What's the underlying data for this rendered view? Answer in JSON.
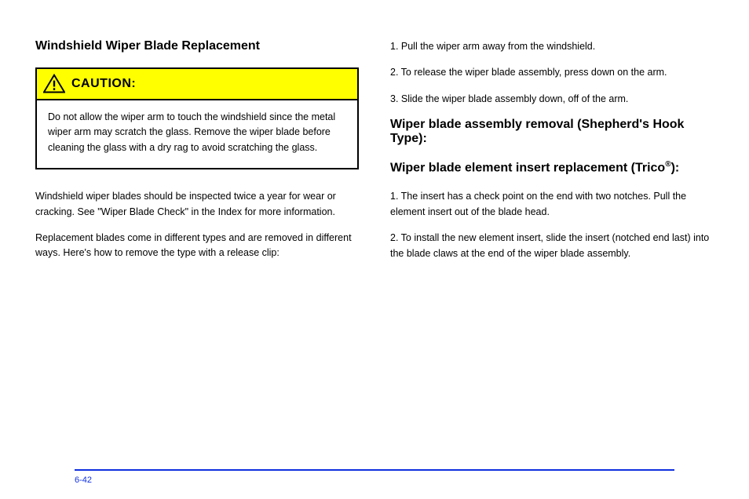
{
  "leftHeading": "Windshield Wiper Blade Replacement",
  "cautionLabel": "CAUTION:",
  "cautionBody": "Do not allow the wiper arm to touch the windshield since the metal wiper arm may scratch the glass. Remove the wiper blade before cleaning the glass with a dry rag to avoid scratching the glass.",
  "leftPara1": "Windshield wiper blades should be inspected twice a year for wear or cracking. See \"Wiper Blade Check\" in the Index for more information.",
  "leftPara2": "Replacement blades come in different types and are removed in different ways. Here's how to remove the type with a release clip:",
  "rightHeading1": "Wiper blade assembly removal (Shepherd's Hook Type):",
  "rightHeading2": "Wiper blade element insert replacement (Trico",
  "rightHeading2Suffix": "):",
  "rightStep1": "1. Pull the wiper arm away from the windshield.",
  "rightStep2": "2. To release the wiper blade assembly, press down on the arm.",
  "rightStep3": "3. Slide the wiper blade assembly down, off of the arm.",
  "rightInsert1": "1. The insert has a check point on the end with two notches. Pull the element insert out of the blade head.",
  "rightInsert2": "2. To install the new element insert, slide the insert (notched end last) into the blade claws at the end of the wiper blade assembly.",
  "footerLeft": "6-42",
  "footerRight": ""
}
